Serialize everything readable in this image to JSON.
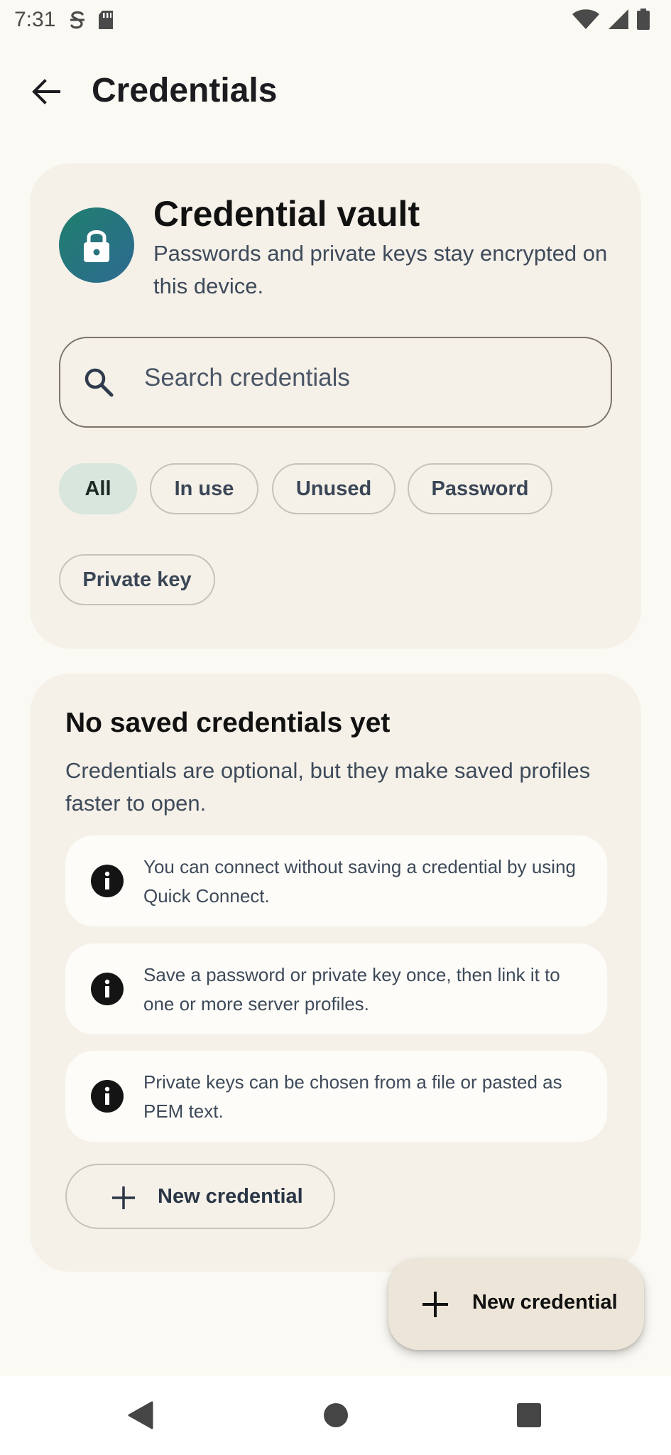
{
  "status_bar": {
    "time": "7:31",
    "icons_left": [
      "s-icon",
      "sd-card-icon"
    ],
    "icons_right": [
      "wifi-icon",
      "signal-icon",
      "battery-icon"
    ]
  },
  "header": {
    "title": "Credentials",
    "back_icon": "arrow-left-icon"
  },
  "vault": {
    "title": "Credential vault",
    "subtitle": "Passwords and private keys stay encrypted on this device.",
    "icon": "lock-icon",
    "avatar_gradient": [
      "#1f7f6c",
      "#2e6a93"
    ]
  },
  "search": {
    "placeholder": "Search credentials",
    "value": ""
  },
  "filters": [
    {
      "label": "All",
      "selected": true
    },
    {
      "label": "In use",
      "selected": false
    },
    {
      "label": "Unused",
      "selected": false
    },
    {
      "label": "Password",
      "selected": false
    },
    {
      "label": "Private key",
      "selected": false
    }
  ],
  "empty_state": {
    "title": "No saved credentials yet",
    "description": "Credentials are optional, but they make saved profiles faster to open.",
    "tips": [
      {
        "icon": "info-icon",
        "text": "You can connect without saving a credential by using Quick Connect."
      },
      {
        "icon": "info-icon",
        "text": "Save a password or private key once, then link it to one or more server profiles."
      },
      {
        "icon": "info-icon",
        "text": "Private keys can be chosen from a file or pasted as PEM text."
      }
    ],
    "button_label": "New credential"
  },
  "fab": {
    "label": "New credential",
    "icon": "plus-icon"
  },
  "colors": {
    "background": "#fbf9f3",
    "card": "#f5f1e9",
    "chip_selected": "#d8e6dd",
    "fab": "#ede6d8"
  }
}
